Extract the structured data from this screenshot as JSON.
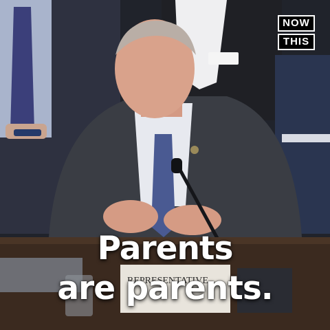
{
  "logo": {
    "line1": "NOW",
    "line2": "THIS"
  },
  "caption": {
    "line1": "Parents",
    "line2": "are parents."
  },
  "placard": {
    "text": "REPRESENTATIVE"
  },
  "colors": {
    "suit": "#3a3d44",
    "tie": "#4a5a92",
    "wood": "#3b2a1f",
    "background": "#1a1c22"
  }
}
